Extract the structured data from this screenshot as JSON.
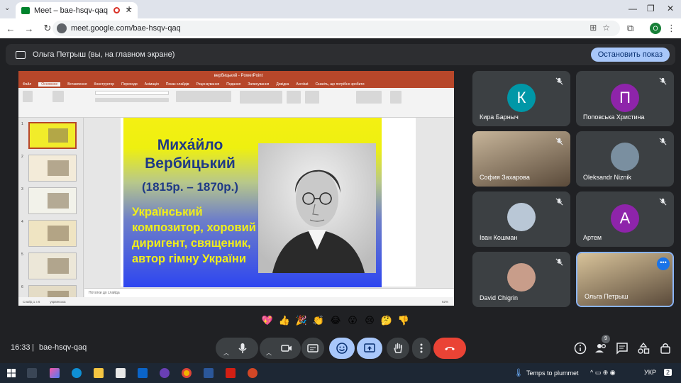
{
  "browser": {
    "tab_title": "Meet – bae-hsqv-qaq",
    "url": "meet.google.com/bae-hsqv-qaq",
    "profile_initial": "O"
  },
  "presenting": {
    "text": "Ольга Петрыш (вы, на главном экране)",
    "stop_label": "Остановить показ"
  },
  "ppt": {
    "title": "вербицький  -  PowerPoint",
    "menu": [
      "Файл",
      "Основное",
      "Вставлення",
      "Конструктор",
      "Переходи",
      "Анімація",
      "Показ слайдів",
      "Рецензування",
      "Подання",
      "Записування",
      "Довідка",
      "Acrobat",
      "Скажіть, що потрібно зробити"
    ],
    "notes_placeholder": "Нотатки до слайда",
    "status_left": "Слайд 1 з 6",
    "status_lang": "українська",
    "zoom": "62%",
    "thumb_numbers": [
      "1",
      "2",
      "3",
      "4",
      "5",
      "6"
    ]
  },
  "slide": {
    "name": "Миха́йло Верби́цький",
    "years": "(1815р. – 1870р.)",
    "description": "Український композитор, хоровий диригент, священик, автор гімну України"
  },
  "participants": [
    {
      "name": "Кира Барныч",
      "initial": "К",
      "color": "#0097a7",
      "muted": true
    },
    {
      "name": "Поповська Христина",
      "initial": "П",
      "color": "#8e24aa",
      "muted": true
    },
    {
      "name": "София Захарова",
      "initial": "",
      "color": "",
      "muted": true
    },
    {
      "name": "Oleksandr Niznik",
      "initial": "",
      "color": "",
      "muted": true
    },
    {
      "name": "Іван Кошман",
      "initial": "",
      "color": "",
      "muted": true
    },
    {
      "name": "Артем",
      "initial": "А",
      "color": "#8e24aa",
      "muted": true
    },
    {
      "name": "David Chigrin",
      "initial": "",
      "color": "",
      "muted": true
    },
    {
      "name": "Ольга Петрыш",
      "initial": "",
      "color": "",
      "muted": false
    }
  ],
  "reactions": [
    "💖",
    "👍",
    "🎉",
    "👏",
    "😂",
    "😮",
    "😢",
    "🤔",
    "👎"
  ],
  "meeting": {
    "time": "16:33",
    "separator": "|",
    "code": "bae-hsqv-qaq",
    "participant_count": "9"
  },
  "taskbar": {
    "weather": "Temps to plummet",
    "lang": "УКР",
    "notifications": "2"
  }
}
